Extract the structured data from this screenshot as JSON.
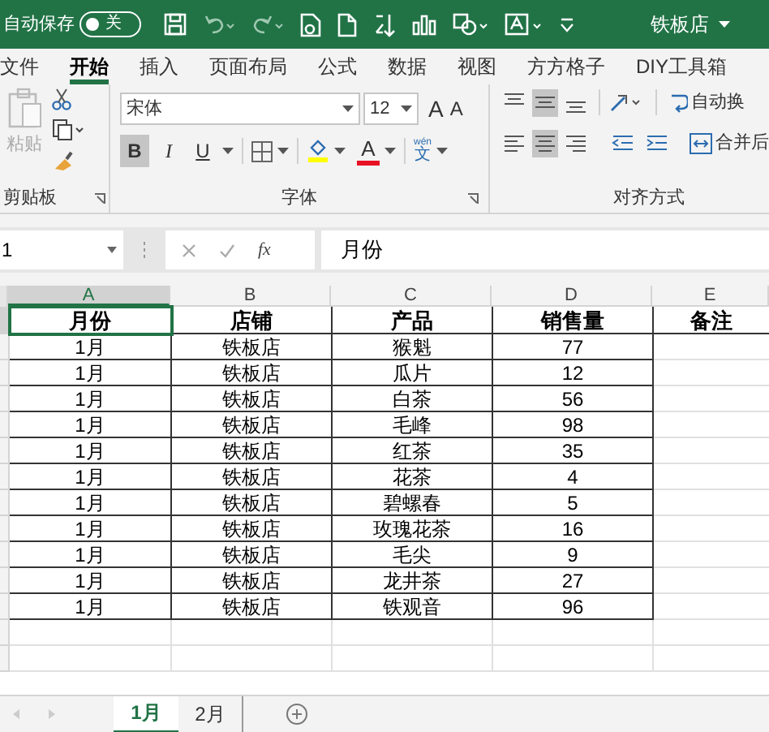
{
  "title_bar": {
    "autosave_label": "自动保存",
    "autosave_on": false,
    "autosave_state": "关",
    "file_name": "铁板店"
  },
  "ribbon_tabs": [
    {
      "label": "文件",
      "selected": false
    },
    {
      "label": "开始",
      "selected": true
    },
    {
      "label": "插入",
      "selected": false
    },
    {
      "label": "页面布局",
      "selected": false
    },
    {
      "label": "公式",
      "selected": false
    },
    {
      "label": "数据",
      "selected": false
    },
    {
      "label": "视图",
      "selected": false
    },
    {
      "label": "方方格子",
      "selected": false
    },
    {
      "label": "DIY工具箱",
      "selected": false
    }
  ],
  "ribbon": {
    "paste_label": "粘贴",
    "font_name": "宋体",
    "font_size": "12",
    "grow_font": "A",
    "shrink_font": "A",
    "style_buttons": [
      {
        "kind": "bold",
        "label": "B",
        "selected": true
      },
      {
        "kind": "italic",
        "label": "I",
        "selected": false
      },
      {
        "kind": "underline",
        "label": "U",
        "selected": false
      }
    ],
    "font_color_label": "A",
    "phonetic_top": "wén",
    "phonetic_bottom": "文",
    "vertical_align": [
      {
        "kind": "top",
        "selected": false
      },
      {
        "kind": "middle",
        "selected": true
      },
      {
        "kind": "bottom",
        "selected": false
      }
    ],
    "horizontal_align": [
      {
        "kind": "left",
        "selected": false
      },
      {
        "kind": "center",
        "selected": true
      },
      {
        "kind": "right",
        "selected": false
      }
    ],
    "wrap_text": "自动换",
    "merge": "合并后",
    "groups": [
      "剪贴板",
      "字体",
      "对齐方式"
    ]
  },
  "formula_bar": {
    "name_box": "1",
    "fx": "fx",
    "formula": "月份"
  },
  "sheet": {
    "columns": [
      {
        "label": "A",
        "selected": true
      },
      {
        "label": "B",
        "selected": false
      },
      {
        "label": "C",
        "selected": false
      },
      {
        "label": "D",
        "selected": false
      },
      {
        "label": "E",
        "selected": false
      }
    ],
    "rows": [
      {
        "selected": true,
        "cells": [
          "月份",
          "店铺",
          "产品",
          "销售量",
          "备注"
        ]
      },
      {
        "selected": false,
        "cells": [
          "1月",
          "铁板店",
          "猴魁",
          "77"
        ]
      },
      {
        "selected": false,
        "cells": [
          "1月",
          "铁板店",
          "瓜片",
          "12"
        ]
      },
      {
        "selected": false,
        "cells": [
          "1月",
          "铁板店",
          "白茶",
          "56"
        ]
      },
      {
        "selected": false,
        "cells": [
          "1月",
          "铁板店",
          "毛峰",
          "98"
        ]
      },
      {
        "selected": false,
        "cells": [
          "1月",
          "铁板店",
          "红茶",
          "35"
        ]
      },
      {
        "selected": false,
        "cells": [
          "1月",
          "铁板店",
          "花茶",
          "4"
        ]
      },
      {
        "selected": false,
        "cells": [
          "1月",
          "铁板店",
          "碧螺春",
          "5"
        ]
      },
      {
        "selected": false,
        "cells": [
          "1月",
          "铁板店",
          "玫瑰花茶",
          "16"
        ]
      },
      {
        "selected": false,
        "cells": [
          "1月",
          "铁板店",
          "毛尖",
          "9"
        ]
      },
      {
        "selected": false,
        "cells": [
          "1月",
          "铁板店",
          "龙井茶",
          "27"
        ]
      },
      {
        "selected": false,
        "cells": [
          "1月",
          "铁板店",
          "铁观音",
          "96"
        ]
      }
    ]
  },
  "sheet_tabs": [
    {
      "label": "1月",
      "selected": true
    },
    {
      "label": "2月",
      "selected": false
    }
  ]
}
